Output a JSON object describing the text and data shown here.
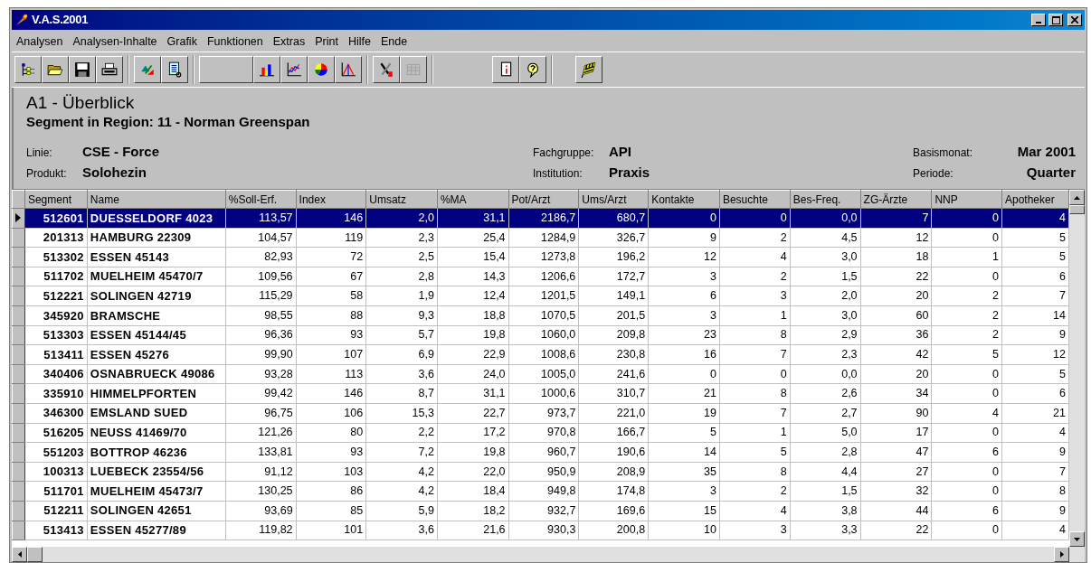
{
  "window": {
    "title": "V.A.S.2001"
  },
  "menu": [
    "Analysen",
    "Analysen-Inhalte",
    "Grafik",
    "Funktionen",
    "Extras",
    "Print",
    "Hilfe",
    "Ende"
  ],
  "toolbar": [
    [
      {
        "kind": "tree",
        "disabled": false
      },
      {
        "kind": "folder",
        "disabled": false
      },
      {
        "kind": "save",
        "disabled": false
      },
      {
        "kind": "printer",
        "disabled": false
      }
    ],
    [
      {
        "kind": "transfer",
        "disabled": false
      },
      {
        "kind": "document",
        "disabled": false
      }
    ],
    [
      {
        "kind": "blank",
        "disabled": false
      },
      {
        "kind": "bars",
        "disabled": false
      },
      {
        "kind": "lines",
        "disabled": false
      },
      {
        "kind": "pie",
        "disabled": false
      },
      {
        "kind": "peak",
        "disabled": false
      }
    ],
    [
      {
        "kind": "tools",
        "disabled": false
      },
      {
        "kind": "grid",
        "disabled": true
      }
    ],
    [
      {
        "kind": "info",
        "disabled": false
      },
      {
        "kind": "help",
        "disabled": false
      }
    ],
    [
      {
        "kind": "flag",
        "disabled": false
      }
    ]
  ],
  "report": {
    "title": "A1 - Überblick",
    "subtitle": "Segment in Region: 11 - Norman Greenspan",
    "fields": [
      [
        {
          "label": "Linie:",
          "value": "CSE - Force"
        },
        {
          "label": "Produkt:",
          "value": "Solohezin"
        }
      ],
      [
        {
          "label": "Fachgruppe:",
          "value": "API"
        },
        {
          "label": "Institution:",
          "value": "Praxis"
        }
      ],
      [
        {
          "label": "Basismonat:",
          "value": "Mar 2001"
        },
        {
          "label": "Periode:",
          "value": "Quarter"
        }
      ]
    ]
  },
  "table": {
    "columns": [
      "Segment",
      "Name",
      "%Soll-Erf.",
      "Index",
      "Umsatz",
      "%MA",
      "Pot/Arzt",
      "Ums/Arzt",
      "Kontakte",
      "Besuchte",
      "Bes-Freq.",
      "ZG-Ärzte",
      "NNP",
      "Apotheker"
    ],
    "rows": [
      {
        "selected": true,
        "cells": [
          "512601",
          "DUESSELDORF 4023",
          "113,57",
          "146",
          "2,0",
          "31,1",
          "2186,7",
          "680,7",
          "0",
          "0",
          "0,0",
          "7",
          "0",
          "4"
        ]
      },
      {
        "selected": false,
        "cells": [
          "201313",
          "HAMBURG 22309",
          "104,57",
          "119",
          "2,3",
          "25,4",
          "1284,9",
          "326,7",
          "9",
          "2",
          "4,5",
          "12",
          "0",
          "5"
        ]
      },
      {
        "selected": false,
        "cells": [
          "513302",
          "ESSEN 45143",
          "82,93",
          "72",
          "2,5",
          "15,4",
          "1273,8",
          "196,2",
          "12",
          "4",
          "3,0",
          "18",
          "1",
          "5"
        ]
      },
      {
        "selected": false,
        "cells": [
          "511702",
          "MUELHEIM 45470/7",
          "109,56",
          "67",
          "2,8",
          "14,3",
          "1206,6",
          "172,7",
          "3",
          "2",
          "1,5",
          "22",
          "0",
          "6"
        ]
      },
      {
        "selected": false,
        "cells": [
          "512221",
          "SOLINGEN 42719",
          "115,29",
          "58",
          "1,9",
          "12,4",
          "1201,5",
          "149,1",
          "6",
          "3",
          "2,0",
          "20",
          "2",
          "7"
        ]
      },
      {
        "selected": false,
        "cells": [
          "345920",
          "BRAMSCHE",
          "98,55",
          "88",
          "9,3",
          "18,8",
          "1070,5",
          "201,5",
          "3",
          "1",
          "3,0",
          "60",
          "2",
          "14"
        ]
      },
      {
        "selected": false,
        "cells": [
          "513303",
          "ESSEN 45144/45",
          "96,36",
          "93",
          "5,7",
          "19,8",
          "1060,0",
          "209,8",
          "23",
          "8",
          "2,9",
          "36",
          "2",
          "9"
        ]
      },
      {
        "selected": false,
        "cells": [
          "513411",
          "ESSEN 45276",
          "99,90",
          "107",
          "6,9",
          "22,9",
          "1008,6",
          "230,8",
          "16",
          "7",
          "2,3",
          "42",
          "5",
          "12"
        ]
      },
      {
        "selected": false,
        "cells": [
          "340406",
          "OSNABRUECK 49086",
          "93,28",
          "113",
          "3,6",
          "24,0",
          "1005,0",
          "241,6",
          "0",
          "0",
          "0,0",
          "20",
          "0",
          "5"
        ]
      },
      {
        "selected": false,
        "cells": [
          "335910",
          "HIMMELPFORTEN",
          "99,42",
          "146",
          "8,7",
          "31,1",
          "1000,6",
          "310,7",
          "21",
          "8",
          "2,6",
          "34",
          "0",
          "6"
        ]
      },
      {
        "selected": false,
        "cells": [
          "346300",
          "EMSLAND SUED",
          "96,75",
          "106",
          "15,3",
          "22,7",
          "973,7",
          "221,0",
          "19",
          "7",
          "2,7",
          "90",
          "4",
          "21"
        ]
      },
      {
        "selected": false,
        "cells": [
          "516205",
          "NEUSS 41469/70",
          "121,26",
          "80",
          "2,2",
          "17,2",
          "970,8",
          "166,7",
          "5",
          "1",
          "5,0",
          "17",
          "0",
          "4"
        ]
      },
      {
        "selected": false,
        "cells": [
          "551203",
          "BOTTROP 46236",
          "133,81",
          "93",
          "7,2",
          "19,8",
          "960,7",
          "190,6",
          "14",
          "5",
          "2,8",
          "47",
          "6",
          "9"
        ]
      },
      {
        "selected": false,
        "cells": [
          "100313",
          "LUEBECK 23554/56",
          "91,12",
          "103",
          "4,2",
          "22,0",
          "950,9",
          "208,9",
          "35",
          "8",
          "4,4",
          "27",
          "0",
          "7"
        ]
      },
      {
        "selected": false,
        "cells": [
          "511701",
          "MUELHEIM 45473/7",
          "130,25",
          "86",
          "4,2",
          "18,4",
          "949,8",
          "174,8",
          "3",
          "2",
          "1,5",
          "32",
          "0",
          "8"
        ]
      },
      {
        "selected": false,
        "cells": [
          "512211",
          "SOLINGEN 42651",
          "93,69",
          "85",
          "5,9",
          "18,2",
          "932,7",
          "169,6",
          "15",
          "4",
          "3,8",
          "44",
          "6",
          "9"
        ]
      },
      {
        "selected": false,
        "cells": [
          "513413",
          "ESSEN 45277/89",
          "119,82",
          "101",
          "3,6",
          "21,6",
          "930,3",
          "200,8",
          "10",
          "3",
          "3,3",
          "22",
          "0",
          "4"
        ]
      }
    ]
  }
}
